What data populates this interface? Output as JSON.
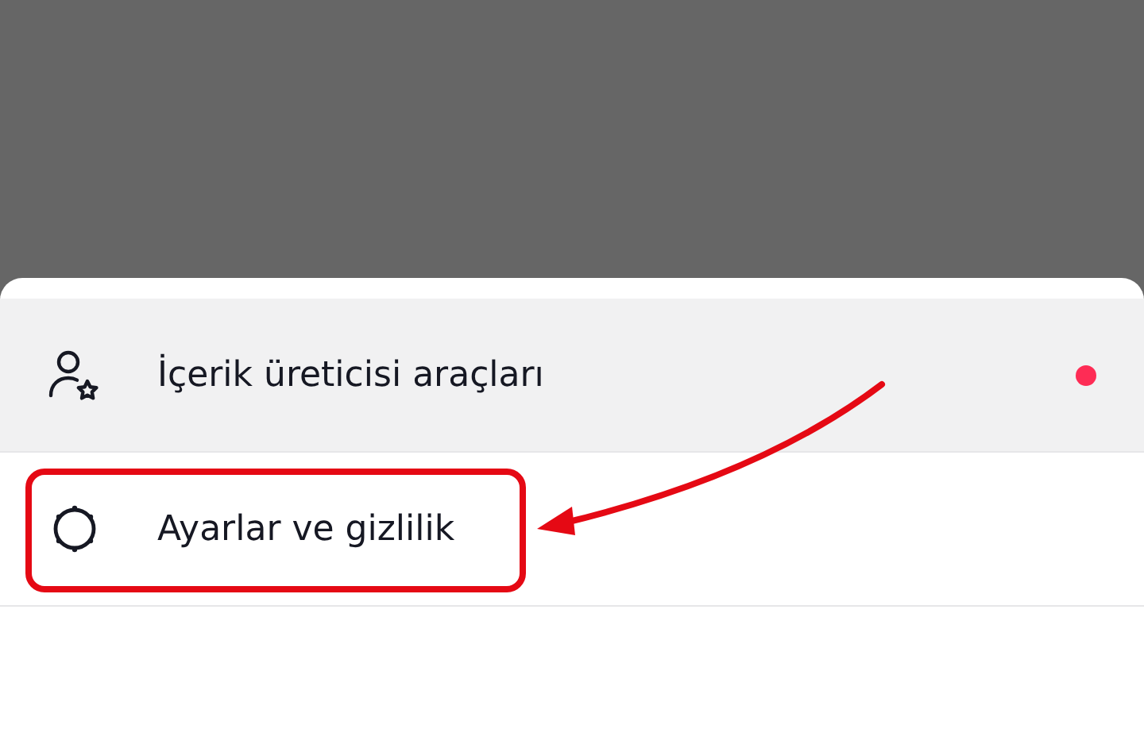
{
  "menu": {
    "items": [
      {
        "label": "İçerik üreticisi araçları",
        "selected": true,
        "badge": true,
        "annotated": false
      },
      {
        "label": "Ayarlar ve gizlilik",
        "selected": false,
        "badge": false,
        "annotated": true
      }
    ]
  }
}
